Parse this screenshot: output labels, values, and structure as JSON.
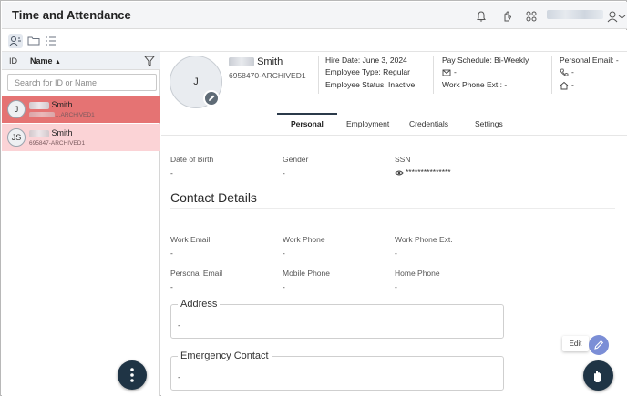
{
  "header": {
    "app_title": "Time and Attendance",
    "icons": [
      "bell-icon",
      "hand-icon",
      "org-chart-icon",
      "user-icon",
      "chevron-down-icon"
    ]
  },
  "toolbar": {
    "icons": [
      "people-icon",
      "folder-icon",
      "list-icon"
    ]
  },
  "sidebar": {
    "columns": {
      "id": "ID",
      "name": "Name"
    },
    "sort": "ascending",
    "search_placeholder": "Search for ID or Name",
    "employees": [
      {
        "initials": "J",
        "name": "Smith",
        "id": "…ARCHIVED1",
        "selected": true
      },
      {
        "initials": "JS",
        "name": "Smith",
        "id": "695847-ARCHIVED1",
        "selected": false
      }
    ]
  },
  "employee": {
    "initial": "J",
    "name": "Smith",
    "id": "6958470-ARCHIVED1",
    "hire_date": "Hire Date: June 3, 2024",
    "employee_type": "Employee Type: Regular",
    "employee_status": "Employee Status: Inactive",
    "pay_schedule": "Pay Schedule: Bi-Weekly",
    "email_value": "-",
    "work_phone_ext": "Work Phone Ext.: -",
    "personal_email": "Personal Email: -",
    "phone_value": "-",
    "home_value": "-"
  },
  "tabs": [
    {
      "label": "Personal",
      "active": true
    },
    {
      "label": "Employment",
      "active": false
    },
    {
      "label": "Credentials",
      "active": false
    },
    {
      "label": "Settings",
      "active": false
    }
  ],
  "personal": {
    "dob": {
      "label": "Date of Birth",
      "value": "-"
    },
    "gender": {
      "label": "Gender",
      "value": "-"
    },
    "ssn": {
      "label": "SSN",
      "value": "***************"
    }
  },
  "contact": {
    "title": "Contact Details",
    "work_email": {
      "label": "Work Email",
      "value": "-"
    },
    "work_phone": {
      "label": "Work Phone",
      "value": "-"
    },
    "work_phone_ext": {
      "label": "Work Phone Ext.",
      "value": "-"
    },
    "personal_email": {
      "label": "Personal Email",
      "value": "-"
    },
    "mobile_phone": {
      "label": "Mobile Phone",
      "value": "-"
    },
    "home_phone": {
      "label": "Home Phone",
      "value": "-"
    }
  },
  "address": {
    "legend": "Address",
    "value": "-"
  },
  "emergency": {
    "legend": "Emergency Contact",
    "value": "-"
  },
  "actions": {
    "edit_label": "Edit"
  },
  "colors": {
    "selected_row": "#e57373",
    "secondary_row": "#fbd3d6",
    "fab": "#1f3445",
    "edit_fab": "#7b8ed6"
  }
}
